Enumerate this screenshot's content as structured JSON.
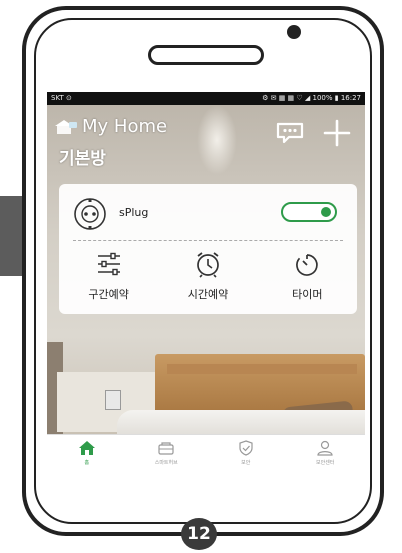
{
  "status_bar": {
    "carrier": "SKT ⊙",
    "right": "⚙ ✉ ▦ ▦ ♡ ◢ 100% ▮ 16:27"
  },
  "header": {
    "home_title": "My Home",
    "room_name": "기본방"
  },
  "device": {
    "name": "sPlug",
    "power_on": true
  },
  "actions": [
    {
      "label": "구간예약",
      "icon": "sliders-icon"
    },
    {
      "label": "시간예약",
      "icon": "alarm-clock-icon"
    },
    {
      "label": "타이머",
      "icon": "timer-icon"
    }
  ],
  "bottom_nav": [
    {
      "label": "홈",
      "icon": "home-icon",
      "active": true
    },
    {
      "label": "스마트허브",
      "icon": "hub-icon",
      "active": false
    },
    {
      "label": "보안",
      "icon": "shield-icon",
      "active": false
    },
    {
      "label": "보안센터",
      "icon": "person-icon",
      "active": false
    }
  ],
  "colors": {
    "accent": "#2e9b4a",
    "status_bar": "#111111",
    "badge": "#3a3a3a"
  },
  "page_number": "12"
}
